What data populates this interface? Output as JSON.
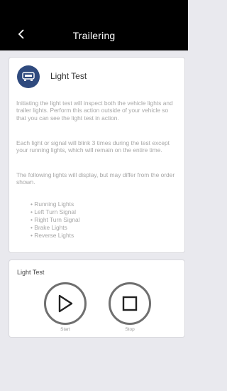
{
  "header": {
    "title": "Trailering",
    "back_icon": "chevron-left-icon"
  },
  "light_test_card": {
    "icon": "trailer-light-icon",
    "title": "Light Test",
    "paragraphs": [
      "Initiating the light test will inspect both the vehicle lights and trailer lights. Perform this action outside of your vehicle so that you can see the light test in action.",
      "Each light or signal will blink 3 times during the test except your running lights, which will remain on the entire time.",
      "The following lights will display, but may differ from the order shown."
    ],
    "lights": [
      "Running Lights",
      "Left Turn Signal",
      "Right Turn Signal",
      "Brake Lights",
      "Reverse Lights"
    ]
  },
  "controls_card": {
    "title": "Light Test",
    "start_label": "Start",
    "stop_label": "Stop",
    "start_icon": "play-icon",
    "stop_icon": "stop-icon"
  },
  "colors": {
    "header_bg": "#000000",
    "icon_bg": "#2f4a7e",
    "page_bg": "#e9e9ee"
  }
}
